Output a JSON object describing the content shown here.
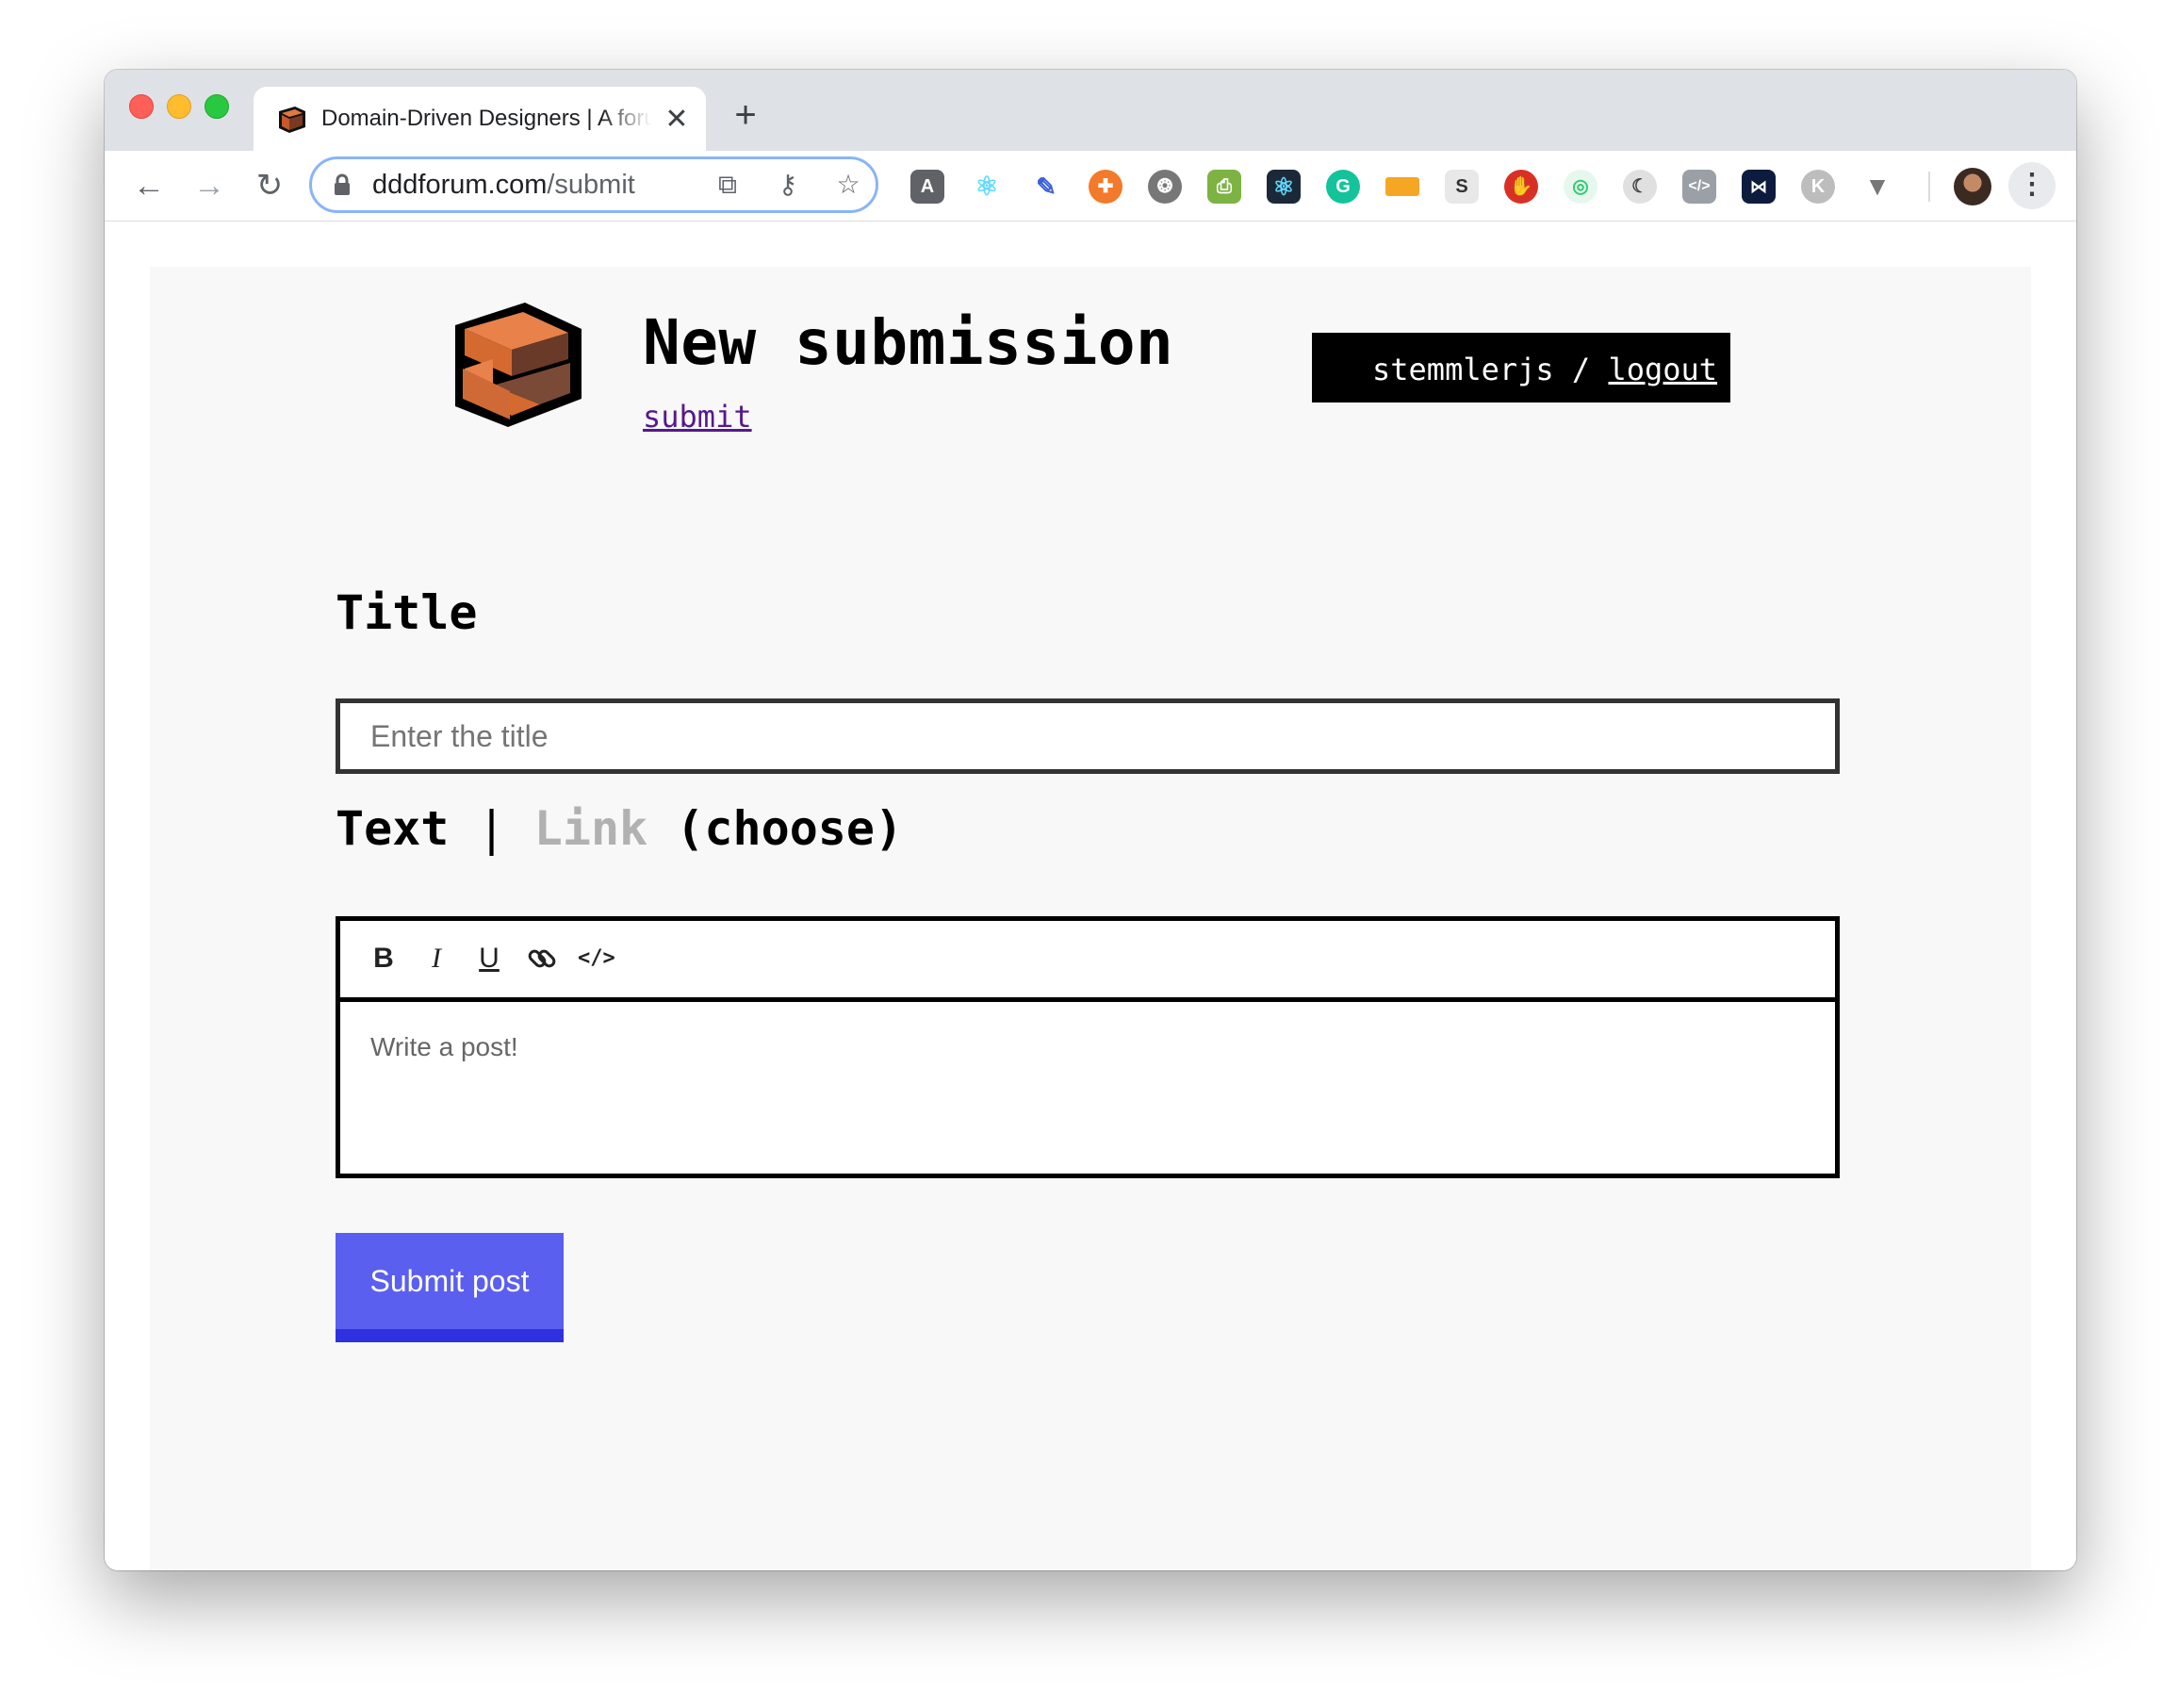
{
  "browser": {
    "tab_title": "Domain-Driven Designers | A forum",
    "tab_close": "✕",
    "new_tab": "+",
    "url_host": "dddforum.com",
    "url_path": "/submit",
    "extensions": [
      "angular-icon",
      "react-devtools-icon",
      "color-picker-icon",
      "help-lifebuoy-icon",
      "film-icon",
      "printer-icon",
      "react-icon",
      "grammarly-icon",
      "analytics-icon",
      "s-icon",
      "adblock-icon",
      "target-icon",
      "moon-icon",
      "code-icon",
      "devtools-icon",
      "k-icon",
      "vue-icon"
    ]
  },
  "header": {
    "title": "New submission",
    "subnav_link": "submit",
    "username": "stemmlerjs",
    "separator": "/",
    "logout": "logout"
  },
  "form": {
    "title_label": "Title",
    "title_placeholder": "Enter the title",
    "type_text": "Text",
    "type_separator": "|",
    "type_link": "Link",
    "type_choose": "(choose)",
    "editor_placeholder": "Write a post!",
    "toolbar": {
      "bold": "B",
      "italic": "I",
      "underline": "U",
      "code": "</>"
    },
    "submit_label": "Submit post"
  },
  "colors": {
    "submit_bg": "#5b5ff0",
    "submit_border": "#2d31e0",
    "link_inactive": "#b1b1b1",
    "page_bg": "#f8f8f8"
  }
}
